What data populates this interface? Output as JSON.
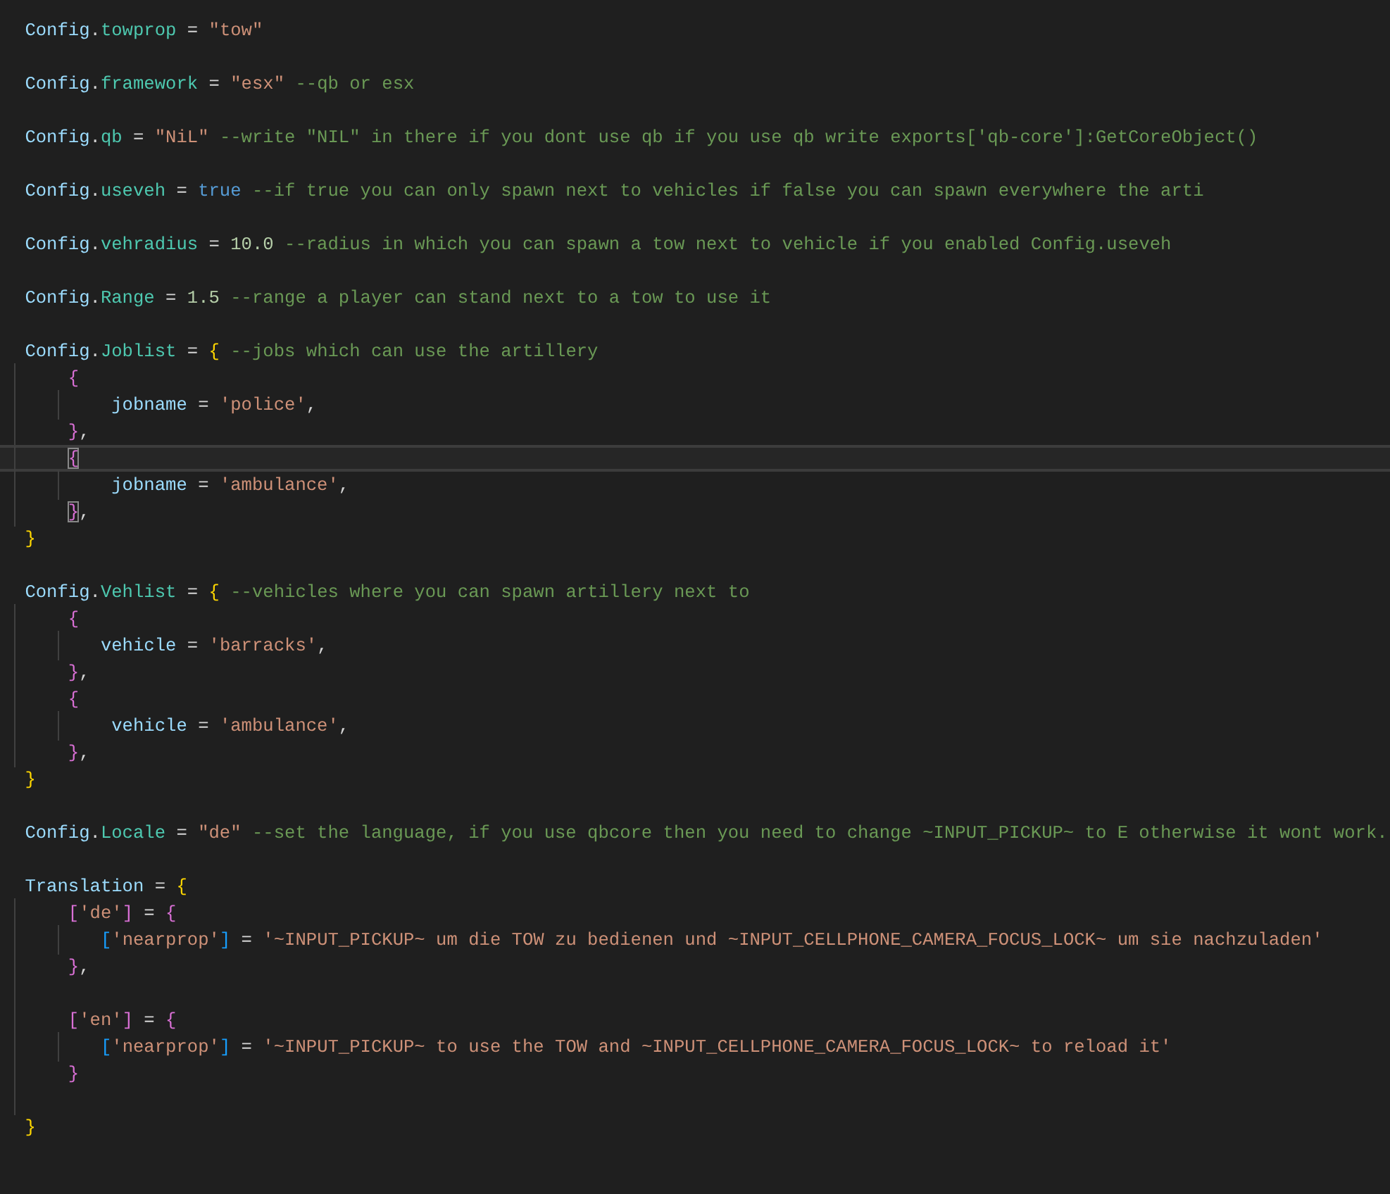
{
  "editor": {
    "lines": [
      {
        "current": false,
        "tokens": [
          {
            "kind": "variable",
            "text": "Config"
          },
          {
            "kind": "punct",
            "text": "."
          },
          {
            "kind": "property",
            "text": "towprop"
          },
          {
            "kind": "punct",
            "text": " = "
          },
          {
            "kind": "string",
            "text": "\"tow\""
          }
        ]
      },
      {
        "current": false
      },
      {
        "current": false,
        "tokens": [
          {
            "kind": "variable",
            "text": "Config"
          },
          {
            "kind": "punct",
            "text": "."
          },
          {
            "kind": "property",
            "text": "framework"
          },
          {
            "kind": "punct",
            "text": " = "
          },
          {
            "kind": "string",
            "text": "\"esx\""
          },
          {
            "kind": "comment",
            "text": " --qb or esx"
          }
        ]
      },
      {
        "current": false
      },
      {
        "current": false,
        "tokens": [
          {
            "kind": "variable",
            "text": "Config"
          },
          {
            "kind": "punct",
            "text": "."
          },
          {
            "kind": "property",
            "text": "qb"
          },
          {
            "kind": "punct",
            "text": " = "
          },
          {
            "kind": "string",
            "text": "\"NiL\""
          },
          {
            "kind": "comment",
            "text": " --write \"NIL\" in there if you dont use qb if you use qb write exports['qb-core']:GetCoreObject()"
          }
        ]
      },
      {
        "current": false
      },
      {
        "current": false,
        "tokens": [
          {
            "kind": "variable",
            "text": "Config"
          },
          {
            "kind": "punct",
            "text": "."
          },
          {
            "kind": "property",
            "text": "useveh"
          },
          {
            "kind": "punct",
            "text": " = "
          },
          {
            "kind": "keyword",
            "text": "true"
          },
          {
            "kind": "comment",
            "text": " --if true you can only spawn next to vehicles if false you can spawn everywhere the arti"
          }
        ]
      },
      {
        "current": false
      },
      {
        "current": false,
        "tokens": [
          {
            "kind": "variable",
            "text": "Config"
          },
          {
            "kind": "punct",
            "text": "."
          },
          {
            "kind": "property",
            "text": "vehradius"
          },
          {
            "kind": "punct",
            "text": " = "
          },
          {
            "kind": "number",
            "text": "10.0"
          },
          {
            "kind": "comment",
            "text": " --radius in which you can spawn a tow next to vehicle if you enabled Config.useveh"
          }
        ]
      },
      {
        "current": false
      },
      {
        "current": false,
        "tokens": [
          {
            "kind": "variable",
            "text": "Config"
          },
          {
            "kind": "punct",
            "text": "."
          },
          {
            "kind": "property",
            "text": "Range"
          },
          {
            "kind": "punct",
            "text": " = "
          },
          {
            "kind": "number",
            "text": "1.5"
          },
          {
            "kind": "comment",
            "text": " --range a player can stand next to a tow to use it"
          }
        ]
      },
      {
        "current": false
      },
      {
        "current": false,
        "tokens": [
          {
            "kind": "variable",
            "text": "Config"
          },
          {
            "kind": "punct",
            "text": "."
          },
          {
            "kind": "property",
            "text": "Joblist"
          },
          {
            "kind": "punct",
            "text": " = "
          },
          {
            "kind": "bracket1",
            "text": "{"
          },
          {
            "kind": "comment",
            "text": " --jobs which can use the artillery"
          }
        ]
      },
      {
        "current": false,
        "tokens": [
          {
            "kind": "bracket2",
            "text": "    {"
          }
        ]
      },
      {
        "current": false,
        "tokens": [
          {
            "kind": "variable",
            "text": "        jobname"
          },
          {
            "kind": "punct",
            "text": " = "
          },
          {
            "kind": "string",
            "text": "'police'"
          },
          {
            "kind": "punct",
            "text": ","
          }
        ]
      },
      {
        "current": false,
        "tokens": [
          {
            "kind": "bracket2",
            "text": "    }"
          },
          {
            "kind": "punct",
            "text": ","
          }
        ]
      },
      {
        "current": true,
        "tokens": [
          {
            "kind": "bracket2",
            "text": "    {",
            "matched": true
          }
        ]
      },
      {
        "current": false,
        "tokens": [
          {
            "kind": "variable",
            "text": "        jobname"
          },
          {
            "kind": "punct",
            "text": " = "
          },
          {
            "kind": "string",
            "text": "'ambulance'"
          },
          {
            "kind": "punct",
            "text": ","
          }
        ]
      },
      {
        "current": false,
        "tokens": [
          {
            "kind": "bracket2",
            "text": "    }",
            "matched": true
          },
          {
            "kind": "punct",
            "text": ","
          }
        ]
      },
      {
        "current": false,
        "tokens": [
          {
            "kind": "bracket1",
            "text": "}"
          }
        ]
      },
      {
        "current": false
      },
      {
        "current": false,
        "tokens": [
          {
            "kind": "variable",
            "text": "Config"
          },
          {
            "kind": "punct",
            "text": "."
          },
          {
            "kind": "property",
            "text": "Vehlist"
          },
          {
            "kind": "punct",
            "text": " = "
          },
          {
            "kind": "bracket1",
            "text": "{"
          },
          {
            "kind": "comment",
            "text": " --vehicles where you can spawn artillery next to"
          }
        ]
      },
      {
        "current": false,
        "tokens": [
          {
            "kind": "bracket2",
            "text": "    {"
          }
        ]
      },
      {
        "current": false,
        "tokens": [
          {
            "kind": "variable",
            "text": "       vehicle"
          },
          {
            "kind": "punct",
            "text": " = "
          },
          {
            "kind": "string",
            "text": "'barracks'"
          },
          {
            "kind": "punct",
            "text": ","
          }
        ]
      },
      {
        "current": false,
        "tokens": [
          {
            "kind": "bracket2",
            "text": "    }"
          },
          {
            "kind": "punct",
            "text": ","
          }
        ]
      },
      {
        "current": false,
        "tokens": [
          {
            "kind": "bracket2",
            "text": "    {"
          }
        ]
      },
      {
        "current": false,
        "tokens": [
          {
            "kind": "variable",
            "text": "        vehicle"
          },
          {
            "kind": "punct",
            "text": " = "
          },
          {
            "kind": "string",
            "text": "'ambulance'"
          },
          {
            "kind": "punct",
            "text": ","
          }
        ]
      },
      {
        "current": false,
        "tokens": [
          {
            "kind": "bracket2",
            "text": "    }"
          },
          {
            "kind": "punct",
            "text": ","
          }
        ]
      },
      {
        "current": false,
        "tokens": [
          {
            "kind": "bracket1",
            "text": "}"
          }
        ]
      },
      {
        "current": false
      },
      {
        "current": false,
        "tokens": [
          {
            "kind": "variable",
            "text": "Config"
          },
          {
            "kind": "punct",
            "text": "."
          },
          {
            "kind": "property",
            "text": "Locale"
          },
          {
            "kind": "punct",
            "text": " = "
          },
          {
            "kind": "string",
            "text": "\"de\""
          },
          {
            "kind": "comment",
            "text": " --set the language, if you use qbcore then you need to change ~INPUT_PICKUP~ to E otherwise it wont work."
          }
        ]
      },
      {
        "current": false
      },
      {
        "current": false,
        "tokens": [
          {
            "kind": "variable",
            "text": "Translation"
          },
          {
            "kind": "punct",
            "text": " = "
          },
          {
            "kind": "bracket1",
            "text": "{"
          }
        ]
      },
      {
        "current": false,
        "tokens": [
          {
            "kind": "bracket2",
            "text": "    ["
          },
          {
            "kind": "string",
            "text": "'de'"
          },
          {
            "kind": "bracket2",
            "text": "]"
          },
          {
            "kind": "punct",
            "text": " = "
          },
          {
            "kind": "bracket2",
            "text": "{"
          }
        ]
      },
      {
        "current": false,
        "tokens": [
          {
            "kind": "bracket3",
            "text": "       ["
          },
          {
            "kind": "string",
            "text": "'nearprop'"
          },
          {
            "kind": "bracket3",
            "text": "]"
          },
          {
            "kind": "punct",
            "text": " = "
          },
          {
            "kind": "string",
            "text": "'~INPUT_PICKUP~ um die TOW zu bedienen und ~INPUT_CELLPHONE_CAMERA_FOCUS_LOCK~ um sie nachzuladen'"
          }
        ]
      },
      {
        "current": false,
        "tokens": [
          {
            "kind": "bracket2",
            "text": "    }"
          },
          {
            "kind": "punct",
            "text": ","
          }
        ]
      },
      {
        "current": false
      },
      {
        "current": false,
        "tokens": [
          {
            "kind": "bracket2",
            "text": "    ["
          },
          {
            "kind": "string",
            "text": "'en'"
          },
          {
            "kind": "bracket2",
            "text": "]"
          },
          {
            "kind": "punct",
            "text": " = "
          },
          {
            "kind": "bracket2",
            "text": "{"
          }
        ]
      },
      {
        "current": false,
        "tokens": [
          {
            "kind": "bracket3",
            "text": "       ["
          },
          {
            "kind": "string",
            "text": "'nearprop'"
          },
          {
            "kind": "bracket3",
            "text": "]"
          },
          {
            "kind": "punct",
            "text": " = "
          },
          {
            "kind": "string",
            "text": "'~INPUT_PICKUP~ to use the TOW and ~INPUT_CELLPHONE_CAMERA_FOCUS_LOCK~ to reload it'"
          }
        ]
      },
      {
        "current": false,
        "tokens": [
          {
            "kind": "bracket2",
            "text": "    }"
          }
        ]
      },
      {
        "current": false
      },
      {
        "current": false,
        "tokens": [
          {
            "kind": "bracket1",
            "text": "}"
          }
        ]
      }
    ]
  }
}
